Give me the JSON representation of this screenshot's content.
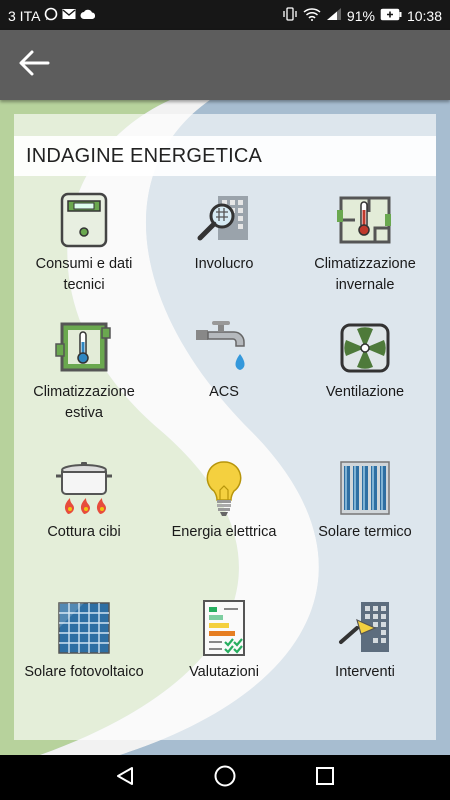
{
  "status_bar": {
    "carrier": "3 ITA",
    "battery": "91%",
    "time": "10:38",
    "icons": [
      "whatsapp-icon",
      "mail-icon",
      "cloud-icon",
      "vibrate-icon",
      "wifi-icon",
      "signal-icon",
      "battery-icon"
    ]
  },
  "app_bar": {
    "back_icon": "arrow-left-icon"
  },
  "panel": {
    "title": "INDAGINE ENERGETICA"
  },
  "tiles": [
    {
      "label": "Consumi e dati tecnici",
      "icon": "meter-icon"
    },
    {
      "label": "Involucro",
      "icon": "building-magnifier-icon"
    },
    {
      "label": "Climatizzazione invernale",
      "icon": "floorplan-thermometer-hot-icon"
    },
    {
      "label": "Climatizzazione estiva",
      "icon": "floorplan-thermometer-cold-icon"
    },
    {
      "label": "ACS",
      "icon": "faucet-icon"
    },
    {
      "label": "Ventilazione",
      "icon": "fan-icon"
    },
    {
      "label": "Cottura cibi",
      "icon": "cooking-pot-icon"
    },
    {
      "label": "Energia elettrica",
      "icon": "light-bulb-icon"
    },
    {
      "label": "Solare termico",
      "icon": "solar-thermal-panel-icon"
    },
    {
      "label": "Solare fotovoltaico",
      "icon": "photovoltaic-panel-icon"
    },
    {
      "label": "Valutazioni",
      "icon": "checklist-icon"
    },
    {
      "label": "Interventi",
      "icon": "building-trowel-icon"
    }
  ],
  "nav_bar": {
    "icons": [
      "back-triangle-icon",
      "home-circle-icon",
      "recents-square-icon"
    ]
  }
}
